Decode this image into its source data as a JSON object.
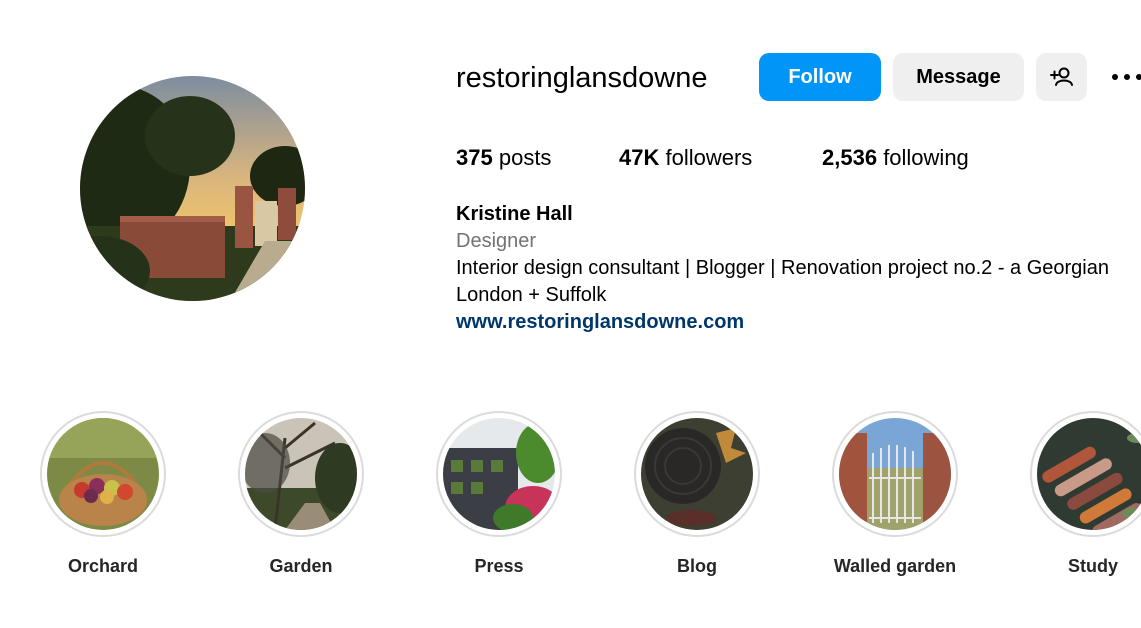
{
  "profile": {
    "username": "restoringlansdowne",
    "follow_label": "Follow",
    "message_label": "Message",
    "add_user_icon": "person-add-icon",
    "more_icon": "ellipsis-icon"
  },
  "stats": {
    "posts_count": "375",
    "posts_label": "posts",
    "followers_count": "47K",
    "followers_label": "followers",
    "following_count": "2,536",
    "following_label": "following"
  },
  "bio": {
    "name": "Kristine Hall",
    "category": "Designer",
    "line1": "Interior design consultant | Blogger | Renovation project no.2 - a Georgian",
    "line2": "London + Suffolk",
    "link": "www.restoringlansdowne.com"
  },
  "highlights": [
    {
      "label": "Orchard"
    },
    {
      "label": "Garden"
    },
    {
      "label": "Press"
    },
    {
      "label": "Blog"
    },
    {
      "label": "Walled garden"
    },
    {
      "label": "Study"
    }
  ],
  "colors": {
    "follow_button": "#0095f6",
    "secondary_button": "#efefef",
    "link": "#00376b",
    "muted_text": "#737373"
  }
}
